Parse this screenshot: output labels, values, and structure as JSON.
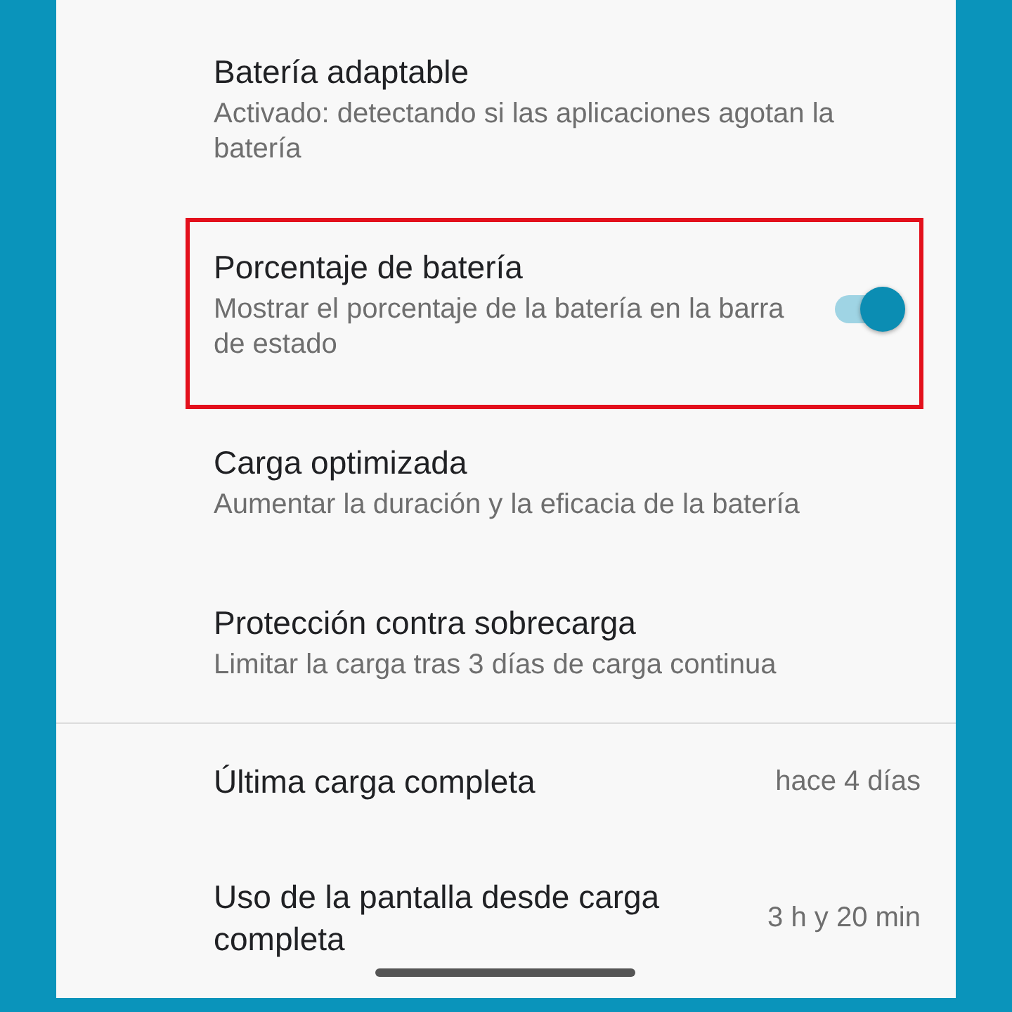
{
  "settings": [
    {
      "kind": "text",
      "title": "Batería adaptable",
      "subtitle": "Activado: detectando si las aplicaciones agotan la batería",
      "highlighted": false
    },
    {
      "kind": "toggle",
      "title": "Porcentaje de batería",
      "subtitle": "Mostrar el porcentaje de la batería en la barra de estado",
      "on": true,
      "highlighted": true
    },
    {
      "kind": "text",
      "title": "Carga optimizada",
      "subtitle": "Aumentar la duración y la eficacia de la batería",
      "highlighted": false
    },
    {
      "kind": "text",
      "title": "Protección contra sobrecarga",
      "subtitle": "Limitar la carga tras 3 días de carga continua",
      "highlighted": false
    }
  ],
  "stats": [
    {
      "label": "Última carga completa",
      "value": "hace 4 días"
    },
    {
      "label": "Uso de la pantalla desde carga completa",
      "value": "3 h y 20 min"
    }
  ]
}
